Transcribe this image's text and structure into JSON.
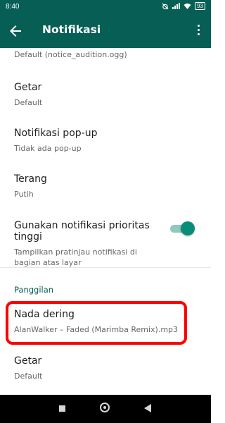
{
  "status": {
    "time": "8:40",
    "battery": "93"
  },
  "appbar": {
    "title": "Notifikasi"
  },
  "settings": [
    {
      "title": "",
      "subtitle": "Default (notice_audition.ogg)"
    },
    {
      "title": "Getar",
      "subtitle": "Default"
    },
    {
      "title": "Notifikasi pop-up",
      "subtitle": "Tidak ada pop-up"
    },
    {
      "title": "Terang",
      "subtitle": "Putih"
    },
    {
      "title": "Gunakan notifikasi prioritas tinggi",
      "subtitle": "Tampilkan pratinjau notifikasi di bagian atas layar",
      "toggle_on": true
    }
  ],
  "section_calls": "Panggilan",
  "calls": [
    {
      "title": "Nada dering",
      "subtitle": "AlanWalker – Faded (Marimba Remix).mp3"
    },
    {
      "title": "Getar",
      "subtitle": "Default"
    }
  ],
  "colors": {
    "primary": "#075e54",
    "accent": "#0a8d78",
    "highlight": "#ff0000"
  }
}
